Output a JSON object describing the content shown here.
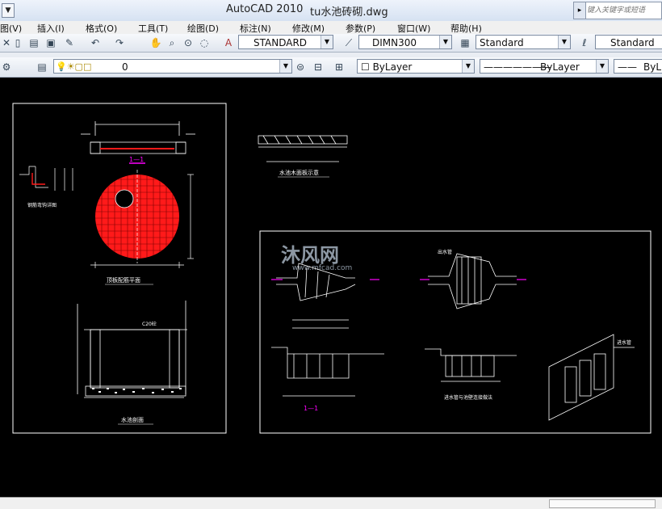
{
  "window": {
    "app_title": "AutoCAD 2010",
    "file_name": "tu水池砖砌.dwg",
    "search_placeholder": "键入关键字或短语"
  },
  "menu": [
    "图(V)",
    "插入(I)",
    "格式(O)",
    "工具(T)",
    "绘图(D)",
    "标注(N)",
    "修改(M)",
    "参数(P)",
    "窗口(W)",
    "帮助(H)"
  ],
  "toolbar1": {
    "text_style": "STANDARD",
    "dim_style": "DIMN300",
    "table_style": "Standard",
    "multileader_style": "Standard"
  },
  "toolbar2": {
    "layer": "0",
    "color": "ByLayer",
    "linetype": "ByLayer",
    "lineweight": "ByL"
  },
  "drawing": {
    "left_sheet": {
      "plan_title": "顶板配筋平面",
      "section_title": "水池剖面",
      "detail_title": "钢筋弯钩详图",
      "section_mark": "1—1",
      "cover_label": "C20砼"
    },
    "top_middle": {
      "title": "水池木面板示意"
    },
    "right_sheet": {
      "section_mark": "1—1",
      "label_a": "进水管",
      "label_b": "出水管",
      "caption_bottom_right": "进水管与池壁连接做法"
    },
    "watermark": {
      "brand": "沐风网",
      "url": "www.mfcad.com"
    }
  },
  "colors": {
    "rebar_red": "#ff1a1a",
    "line_white": "#ffffff",
    "magenta": "#ff00ff",
    "ui_bg": "#dfe5ee"
  }
}
